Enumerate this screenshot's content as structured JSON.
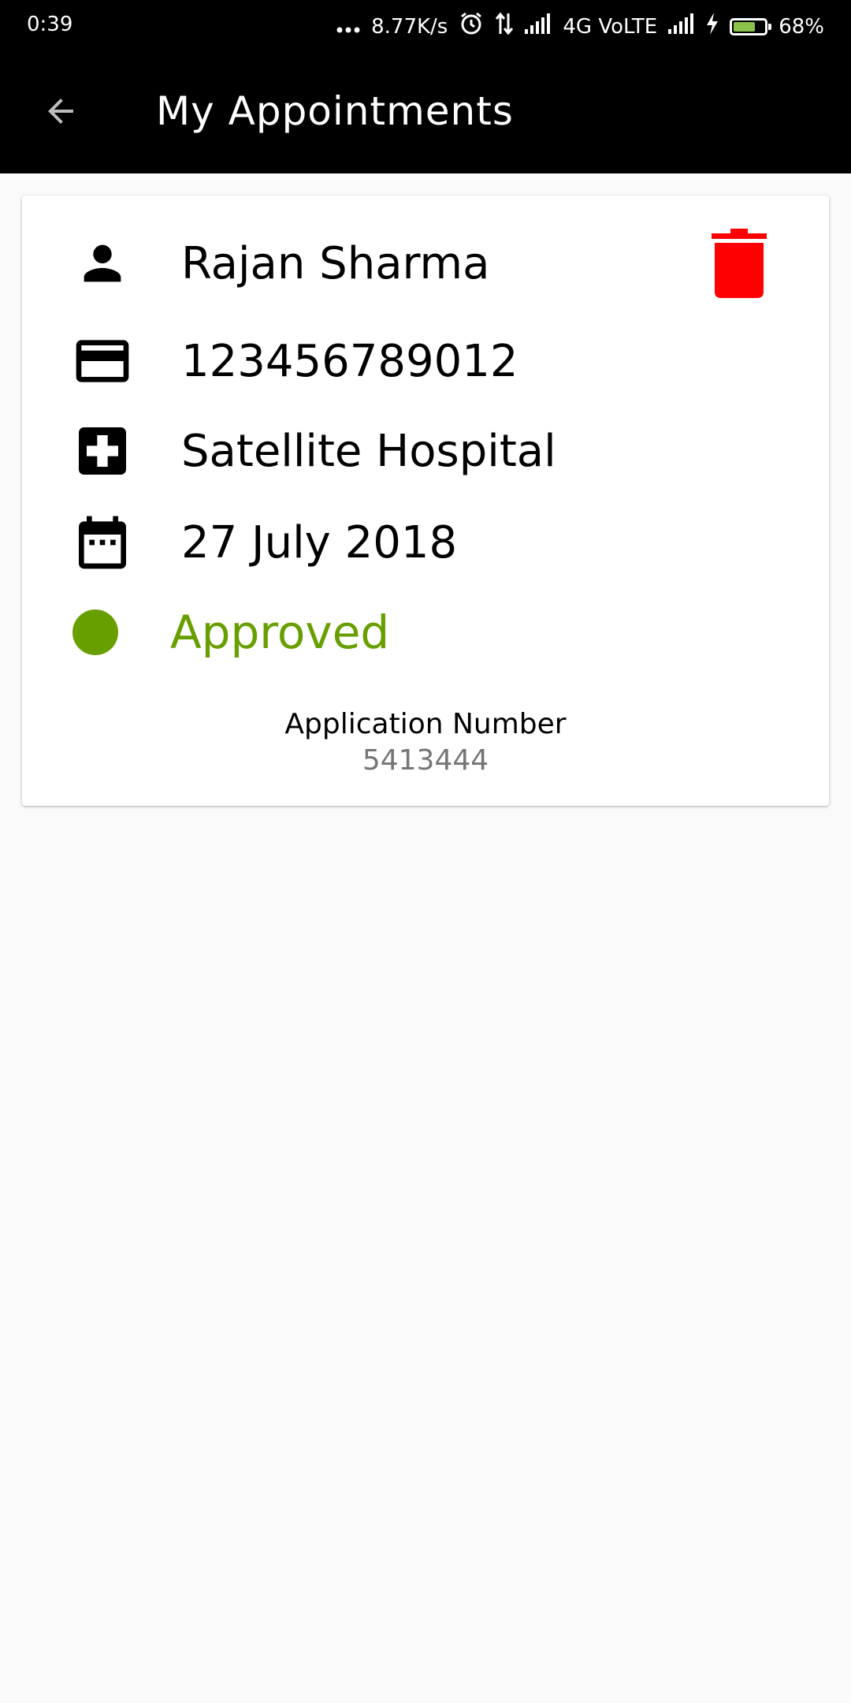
{
  "status_bar": {
    "time": "0:39",
    "network_speed": "8.77K/s",
    "network_type": "4G VoLTE",
    "battery_percent": "68%",
    "battery_level": 0.68,
    "battery_color": "#8bc34a",
    "icons": [
      "more-dots-icon",
      "alarm-icon",
      "data-transfer-icon",
      "signal-icon",
      "signal-icon",
      "charging-icon",
      "battery-icon"
    ]
  },
  "app_bar": {
    "title": "My Appointments",
    "back_icon": "arrow-left-icon",
    "background": "#000000"
  },
  "appointment": {
    "name": "Rajan Sharma",
    "card_number": "123456789012",
    "hospital": "Satellite Hospital",
    "date": "27 July 2018",
    "status": "Approved",
    "status_color": "#689f00",
    "application_number_label": "Application Number",
    "application_number": "5413444",
    "delete_color": "#ff0000",
    "icons": {
      "name": "person-icon",
      "card_number": "credit-card-icon",
      "hospital": "hospital-icon",
      "date": "calendar-icon",
      "delete": "trash-icon"
    }
  }
}
